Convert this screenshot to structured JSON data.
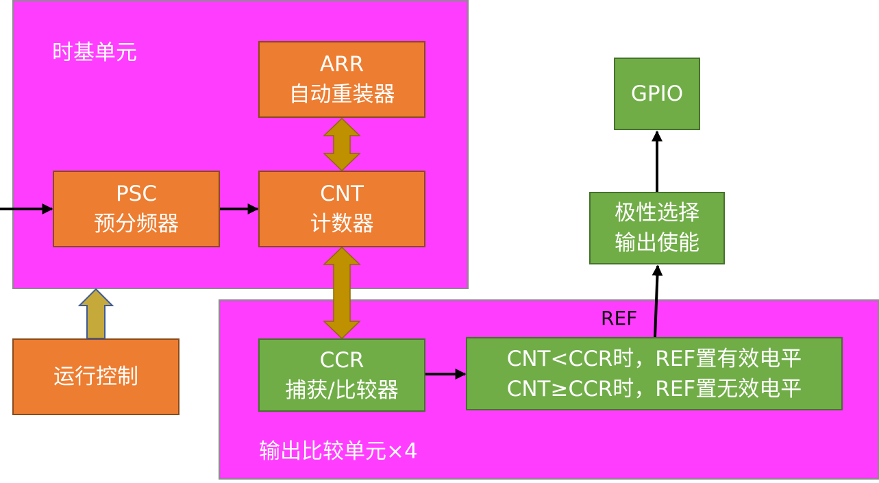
{
  "colors": {
    "region": "#ff3dff",
    "orange_box": "#ed7d31",
    "green_box": "#70ad47",
    "double_arrow": "#bf9000",
    "up_arrow": "#c5a93a",
    "arrow": "#000000"
  },
  "time_base_unit": {
    "title": "时基单元",
    "arr": {
      "line1": "ARR",
      "line2": "自动重装器"
    },
    "psc": {
      "line1": "PSC",
      "line2": "预分频器"
    },
    "cnt": {
      "line1": "CNT",
      "line2": "计数器"
    }
  },
  "run_control": {
    "label": "运行控制"
  },
  "output_compare_unit": {
    "title": "输出比较单元×4",
    "ref_label": "REF",
    "ccr": {
      "line1": "CCR",
      "line2": "捕获/比较器"
    },
    "ref_logic": {
      "line1": "CNT<CCR时，REF置有效电平",
      "line2": "CNT≥CCR时，REF置无效电平"
    }
  },
  "polarity": {
    "line1": "极性选择",
    "line2": "输出使能"
  },
  "gpio": {
    "label": "GPIO"
  }
}
